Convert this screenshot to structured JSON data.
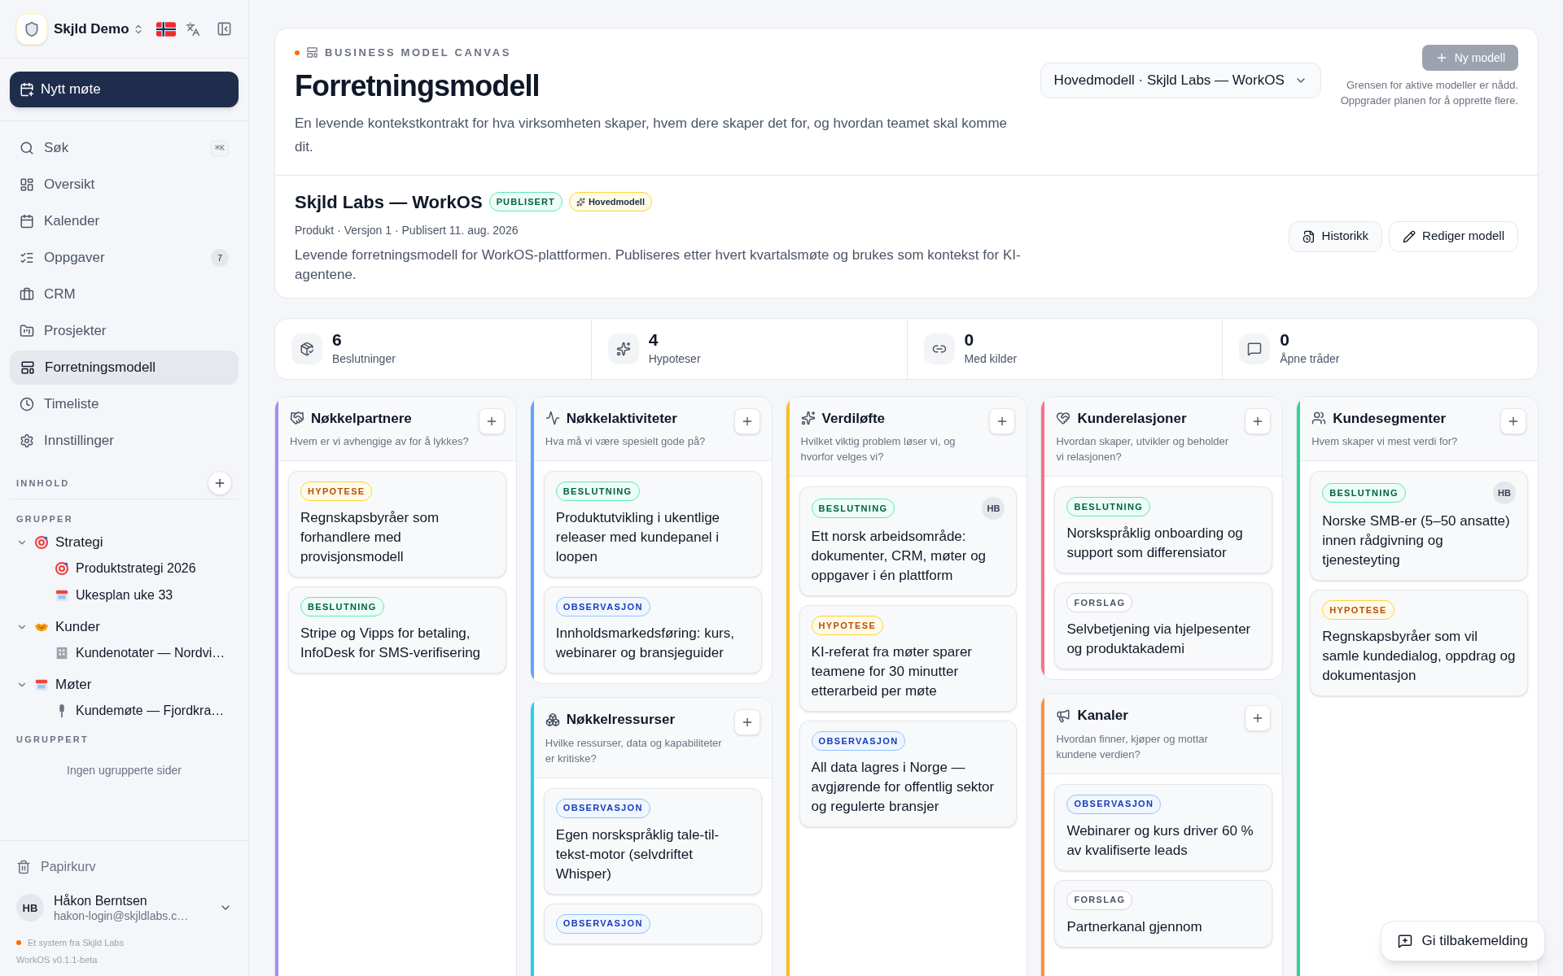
{
  "sidebar": {
    "workspace": "Skjld Demo",
    "new_meeting": "Nytt møte",
    "nav": [
      {
        "label": "Søk",
        "shortcut": "⌘K",
        "selected": false
      },
      {
        "label": "Oversikt",
        "selected": false
      },
      {
        "label": "Kalender",
        "selected": false
      },
      {
        "label": "Oppgaver",
        "badge": "7",
        "selected": false
      },
      {
        "label": "CRM",
        "selected": false
      },
      {
        "label": "Prosjekter",
        "selected": false
      },
      {
        "label": "Forretningsmodell",
        "selected": true
      },
      {
        "label": "Timeliste",
        "selected": false
      },
      {
        "label": "Innstillinger",
        "selected": false
      }
    ],
    "content_heading": "INNHOLD",
    "groups_heading": "GRUPPER",
    "groups": [
      {
        "label": "Strategi",
        "expanded": true,
        "children": [
          {
            "label": "Produktstrategi 2026"
          },
          {
            "label": "Ukesplan uke 33"
          }
        ]
      },
      {
        "label": "Kunder",
        "expanded": true,
        "children": [
          {
            "label": "Kundenotater — Nordvi…"
          }
        ]
      },
      {
        "label": "Møter",
        "expanded": true,
        "children": [
          {
            "label": "Kundemøte — Fjordkra…"
          }
        ]
      }
    ],
    "ungrouped_heading": "UGRUPPERT",
    "ungrouped_empty": "Ingen ugrupperte sider",
    "trash": "Papirkurv",
    "user": {
      "initials": "HB",
      "name": "Håkon Berntsen",
      "email": "hakon-login@skjldlabs.c…"
    },
    "footer": {
      "credit": "Et system fra Skjld Labs",
      "version": "WorkOS v0.1.1-beta"
    }
  },
  "header": {
    "eyebrow": "BUSINESS MODEL CANVAS",
    "title": "Forretningsmodell",
    "description": "En levende kontekstkontrakt for hva virksomheten skaper, hvem dere skaper det for, og hvordan teamet skal komme dit.",
    "model_select": "Hovedmodell · Skjld Labs — WorkOS",
    "new_model": {
      "label": "Ny modell",
      "disabled": true
    },
    "limit_note": [
      "Grensen for aktive modeller er nådd.",
      "Oppgrader planen for å opprette flere."
    ]
  },
  "model": {
    "name": "Skjld Labs — WorkOS",
    "badges": [
      {
        "label": "PUBLISERT",
        "kind": "status"
      },
      {
        "label": "Hovedmodell",
        "kind": "main"
      }
    ],
    "meta": "Produkt · Versjon 1 · Publisert 11. aug. 2026",
    "description": "Levende forretningsmodell for WorkOS-plattformen. Publiseres etter hvert kvartalsmøte og brukes som kontekst for KI-agentene.",
    "buttons": [
      "Historikk",
      "Rediger modell"
    ]
  },
  "stats": [
    {
      "value": "6",
      "label": "Beslutninger"
    },
    {
      "value": "4",
      "label": "Hypoteser"
    },
    {
      "value": "0",
      "label": "Med kilder"
    },
    {
      "value": "0",
      "label": "Åpne tråder"
    }
  ],
  "columns": [
    {
      "blocks": [
        {
          "title": "Nøkkelpartnere",
          "question": "Hvem er vi avhengige av for å lykkes?",
          "color": "#a78bfa",
          "cards": [
            {
              "kind": "hypothesis",
              "tag": "HYPOTESE",
              "text": "Regnskapsbyråer som forhandlere med provisjonsmodell"
            },
            {
              "kind": "decision",
              "tag": "BESLUTNING",
              "text": "Stripe og Vipps for betaling, InfoDesk for SMS-verifisering"
            }
          ]
        }
      ]
    },
    {
      "blocks": [
        {
          "title": "Nøkkelaktiviteter",
          "question": "Hva må vi være spesielt gode på?",
          "color": "#60a5fa",
          "cards": [
            {
              "kind": "decision",
              "tag": "BESLUTNING",
              "text": "Produktutvikling i ukentlige releaser med kundepanel i loopen"
            },
            {
              "kind": "observation",
              "tag": "OBSERVASJON",
              "text": "Innholdsmarkedsføring: kurs, webinarer og bransjeguider"
            }
          ]
        },
        {
          "title": "Nøkkelressurser",
          "question": "Hvilke ressurser, data og kapabiliteter er kritiske?",
          "color": "#22d3ee",
          "cards": [
            {
              "kind": "observation",
              "tag": "OBSERVASJON",
              "text": "Egen norskspråklig tale-til-tekst-motor (selvdriftet Whisper)"
            },
            {
              "kind": "observation",
              "tag": "OBSERVASJON"
            }
          ]
        }
      ]
    },
    {
      "blocks": [
        {
          "title": "Verdiløfte",
          "question": "Hvilket viktig problem løser vi, og hvorfor velges vi?",
          "color": "#fbbf24",
          "cards": [
            {
              "kind": "decision",
              "tag": "BESLUTNING",
              "avatar": "HB",
              "text": "Ett norsk arbeidsområde: dokumenter, CRM, møter og oppgaver i én plattform"
            },
            {
              "kind": "hypothesis",
              "tag": "HYPOTESE",
              "text": "KI-referat fra møter sparer teamene for 30 minutter etterarbeid per møte"
            },
            {
              "kind": "observation",
              "tag": "OBSERVASJON",
              "text": "All data lagres i Norge — avgjørende for offentlig sektor og regulerte bransjer"
            }
          ]
        }
      ]
    },
    {
      "blocks": [
        {
          "title": "Kunderelasjoner",
          "question": "Hvordan skaper, utvikler og beholder vi relasjonen?",
          "color": "#fb7185",
          "cards": [
            {
              "kind": "decision",
              "tag": "BESLUTNING",
              "text": "Norskspråklig onboarding og support som differensiator"
            },
            {
              "kind": "proposal",
              "tag": "FORSLAG",
              "text": "Selvbetjening via hjelpesenter og produktakademi"
            }
          ]
        },
        {
          "title": "Kanaler",
          "question": "Hvordan finner, kjøper og mottar kundene verdien?",
          "color": "#fb923c",
          "cards": [
            {
              "kind": "observation",
              "tag": "OBSERVASJON",
              "text": "Webinarer og kurs driver 60 % av kvalifiserte leads"
            },
            {
              "kind": "proposal",
              "tag": "FORSLAG",
              "text": "Partnerkanal gjennom"
            }
          ]
        }
      ]
    },
    {
      "blocks": [
        {
          "title": "Kundesegmenter",
          "question": "Hvem skaper vi mest verdi for?",
          "color": "#34d399",
          "cards": [
            {
              "kind": "decision",
              "tag": "BESLUTNING",
              "avatar": "HB",
              "text": "Norske SMB-er (5–50 ansatte) innen rådgivning og tjenesteyting"
            },
            {
              "kind": "hypothesis",
              "tag": "HYPOTESE",
              "text": "Regnskapsbyråer som vil samle kundedialog, oppdrag og dokumentasjon"
            }
          ]
        }
      ]
    }
  ],
  "feedback_button": "Gi tilbakemelding"
}
